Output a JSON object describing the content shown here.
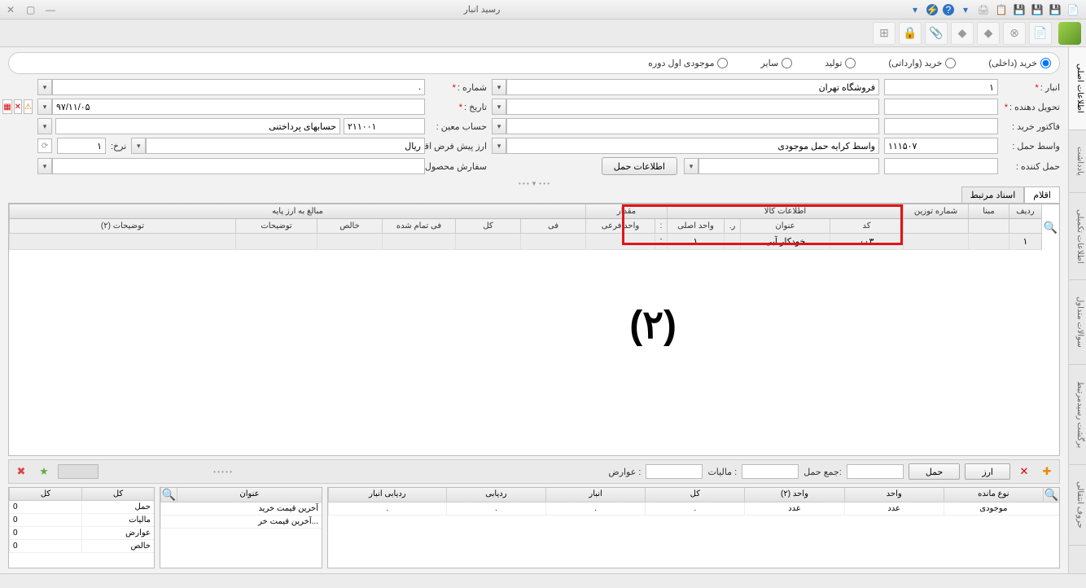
{
  "window": {
    "title": "رسید انبار"
  },
  "radios": {
    "opt1": "خرید (داخلی)",
    "opt2": "خرید (وارداتی)",
    "opt3": "تولید",
    "opt4": "سایر",
    "opt5": "موجودی اول دوره"
  },
  "form": {
    "anbar_label": "انبار :",
    "anbar_code": "۱",
    "anbar_name": "فروشگاه تهران",
    "shomare_label": "شماره :",
    "shomare_val": ".",
    "tahvil_label": "تحویل دهنده :",
    "tahvil_val": "",
    "tarikh_label": "تاریخ :",
    "tarikh_val": "۹۷/۱۱/۰۵",
    "faktor_label": "فاکتور خرید :",
    "faktor_val": "",
    "moein_label": "حساب معین :",
    "moein_code": "۲۱۱۰۰۱",
    "moein_name": "حسابهای پرداختنی",
    "vaset_label": "واسط حمل :",
    "vaset_code": "۱۱۱۵۰۷",
    "vaset_name": "واسط کرایه حمل موجودی",
    "arz_label": "ارز پیش فرض اقلام:",
    "arz_val": "ریال",
    "nerkh_label": "نرخ:",
    "nerkh_val": "۱",
    "haml_label": "حمل کننده :",
    "haml_info_btn": "اطلاعات حمل",
    "sefaresh_label": "سفارش محصول:"
  },
  "sidetabs": {
    "t1": "اطلاعات اصلی",
    "t2": "یادداشت",
    "t3": "اطلاعات تکمیلی",
    "t4": "سوالات متداول",
    "t5": "برگشت رسیدمرتبط",
    "t6": "حروف انتقالی"
  },
  "gridtabs": {
    "tab1": "اقلام",
    "tab2": "اسناد مرتبط"
  },
  "grid_groups": {
    "info": "اطلاعات کالا",
    "meghdar": "مقدار",
    "mabalegh": "مبالغ به ارز پایه"
  },
  "grid_cols": {
    "radif": "ردیف",
    "mabna": "مبنا",
    "tozin": "شماره توزین",
    "code": "کد",
    "onvan": "عنوان",
    "ra": "ر.",
    "vahed_asli": "واحد اصلی",
    "cln": ":",
    "vahed_farei": "واحد فرعی",
    "fi": "فی",
    "kol": "کل",
    "fi_tamam": "فی تمام شده",
    "khales": "خالص",
    "tozihat": "توضیحات",
    "tozihat2": "توضیحات (۲)"
  },
  "grid_row": {
    "radif": "۱",
    "code": "۰۰۳",
    "onvan": "خودکار آبی",
    "vahed_asli": "۱",
    "cln": ":"
  },
  "overlay": "(۲)",
  "bbar": {
    "arz_btn": "ارز",
    "haml_btn": "حمل",
    "jame_label": "جمع حمل:",
    "maliat_label": "مالیات :",
    "avarez_label": "عوارض :"
  },
  "panel1": {
    "h1": "کل",
    "h2": "کل",
    "r1": "حمل",
    "r2": "مالیات",
    "r3": "عوارض",
    "r4": "خالص",
    "v": "0"
  },
  "panel2": {
    "h": "عنوان",
    "r1": "آخرین قیمت خرید",
    "r2": "آخرین قیمت خر..."
  },
  "panel3": {
    "h_type": "نوع مانده",
    "h_vahed": "واحد",
    "h_vahed2": "واحد (۲)",
    "h_kol": "کل",
    "h_anbar": "انبار",
    "h_radyabi": "ردیابی",
    "h_radyabi_anbar": "ردیابی انبار",
    "r_type": "موجودی",
    "r_vahed": "عدد",
    "r_vahed2": "عدد",
    "dot": "."
  }
}
